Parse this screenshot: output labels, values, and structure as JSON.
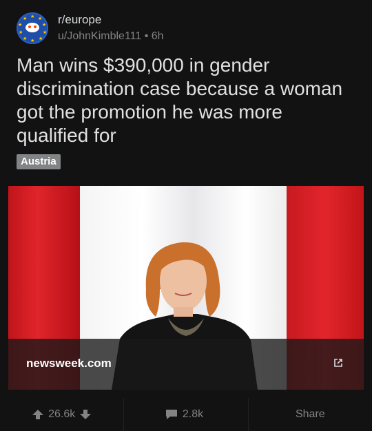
{
  "post": {
    "subreddit": "r/europe",
    "author": "u/JohnKimble111",
    "age": "6h",
    "separator": "•",
    "title": "Man wins $390,000 in gender discrimination case because a woman got the promotion he was more qualified for",
    "flair": "Austria",
    "link_domain": "newsweek.com"
  },
  "actions": {
    "score": "26.6k",
    "comments": "2.8k",
    "share": "Share"
  },
  "colors": {
    "background": "#121212",
    "flag_red": "#e0252b",
    "flair_bg": "#818384"
  },
  "icons": [
    "subreddit-avatar-icon",
    "upvote-icon",
    "downvote-icon",
    "comment-icon",
    "external-link-icon"
  ]
}
